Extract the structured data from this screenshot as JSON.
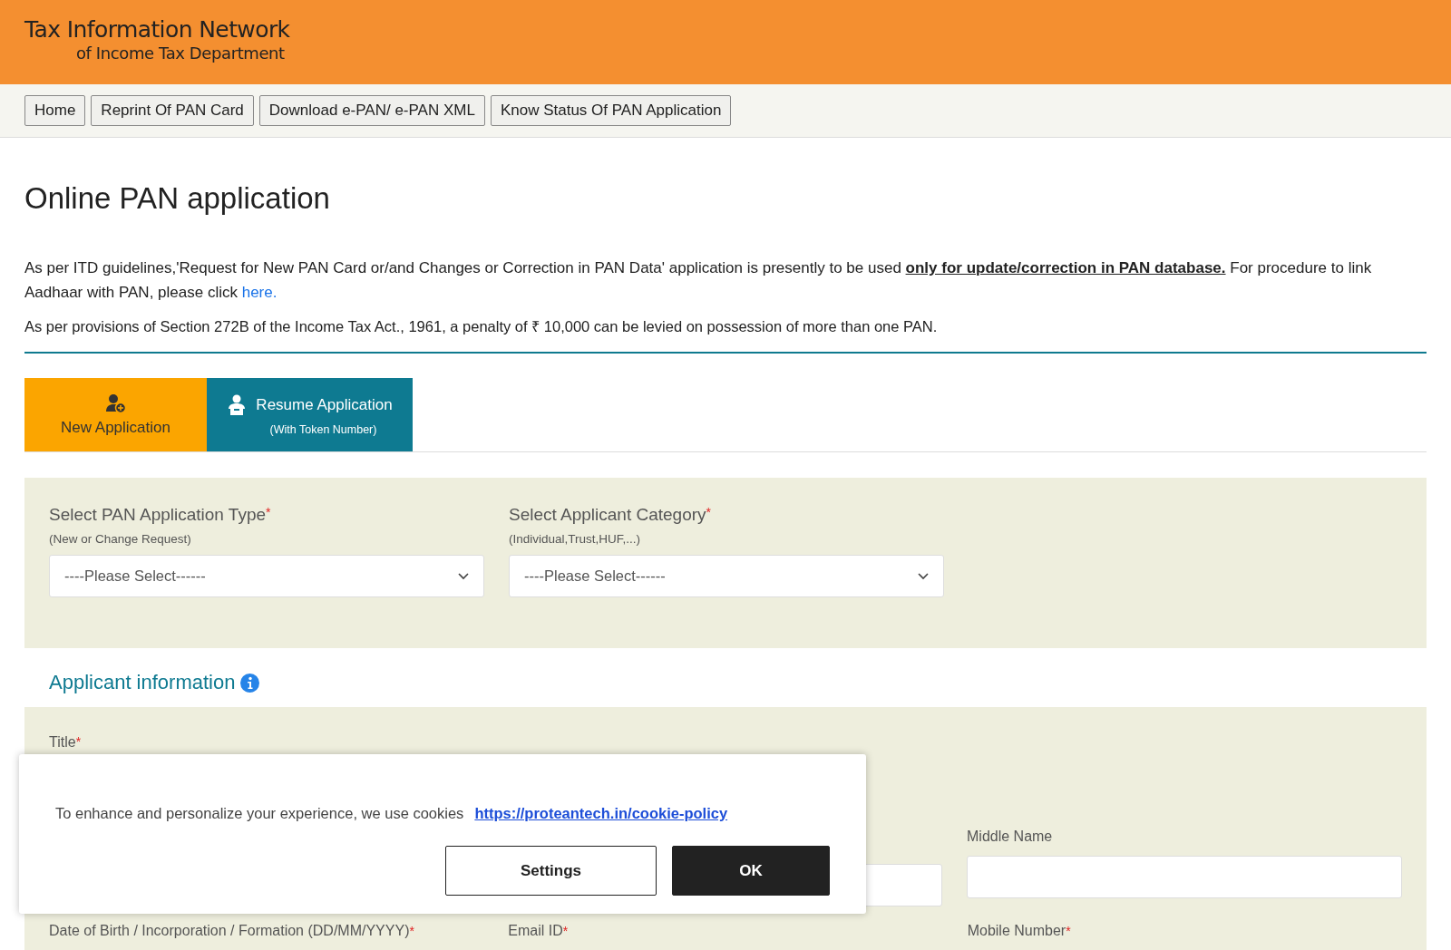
{
  "header": {
    "title": "Tax Information Network",
    "subtitle": "of Income Tax Department"
  },
  "nav": [
    "Home",
    "Reprint Of PAN Card",
    "Download e-PAN/ e-PAN XML",
    "Know Status Of PAN Application"
  ],
  "page_title": "Online PAN application",
  "notice": {
    "text": "As per ITD guidelines,'Request for New PAN Card or/and Changes or Correction in PAN Data' application is presently to be used **only for update/correction in PAN database.** For procedure to link Aadhaar with PAN, please click",
    "link": "here."
  },
  "penalty": "As per provisions of Section 272B of the Income Tax Act., 1961, a penalty of ₹ 10,000 can be levied on possession of more than one PAN.",
  "tabs": [
    {
      "kind": "new",
      "label": "New Application",
      "selected": true
    },
    {
      "kind": "resume",
      "label": "Resume Application",
      "sublabel": "(With Token Number)",
      "selected": false
    }
  ],
  "selects": [
    {
      "label": "Select PAN Application Type",
      "required_mark": "*",
      "hint": "(New or Change Request)",
      "value": "----Please Select------"
    },
    {
      "label": "Select Applicant Category",
      "required_mark": "*",
      "hint": "(Individual,Trust,HUF,...)",
      "value": "----Please Select------"
    }
  ],
  "applicant_info": {
    "heading": "Applicant information",
    "title_label": "Title",
    "title_mark": "*",
    "middle_name_label": "Middle Name",
    "bottom_labels": [
      {
        "label": "Date of Birth / Incorporation / Formation (DD/MM/YYYY)",
        "required_mark": "*"
      },
      {
        "label": "Email ID",
        "required_mark": "*"
      },
      {
        "label": "Mobile Number",
        "required_mark": "*"
      }
    ]
  },
  "cookie_banner": {
    "text": "To enhance and personalize your experience, we use cookies",
    "link": "https://proteantech.in/cookie-policy",
    "buttons": [
      {
        "kind": "secondary",
        "label": "Settings"
      },
      {
        "kind": "primary",
        "label": "OK"
      }
    ]
  }
}
